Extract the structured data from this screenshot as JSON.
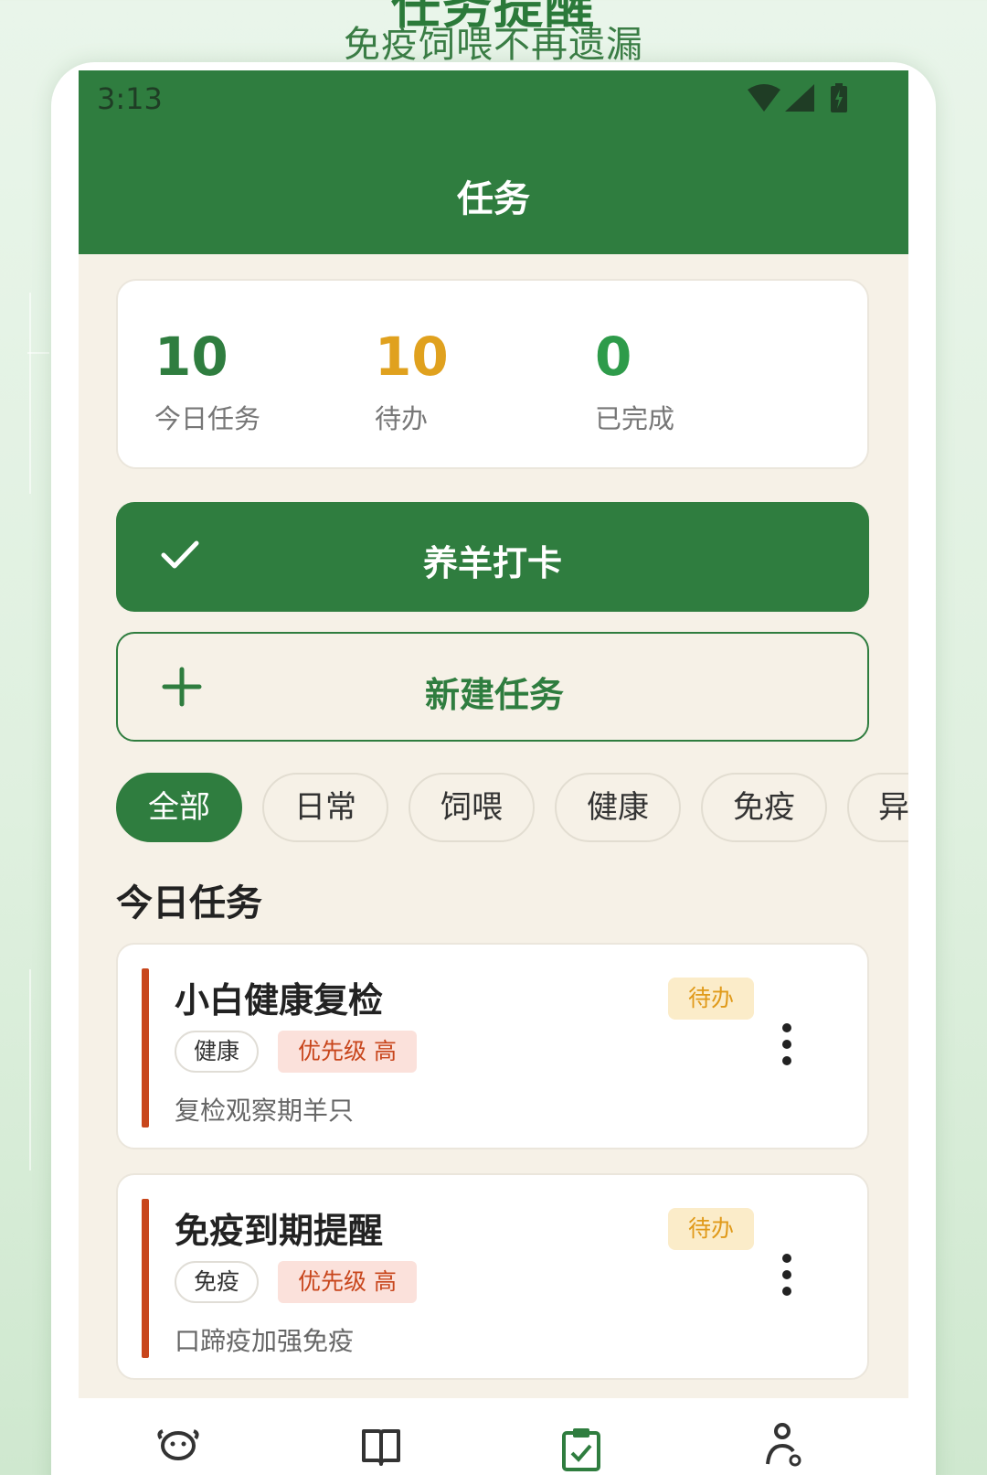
{
  "promo": {
    "title": "任务提醒",
    "subtitle": "免疫饲喂不再遗漏"
  },
  "statusbar": {
    "time": "3:13",
    "icons": [
      "wifi-icon",
      "signal-icon",
      "battery-icon"
    ]
  },
  "appbar": {
    "title": "任务"
  },
  "stats": [
    {
      "value": "10",
      "label": "今日任务",
      "color": "#2f7d3f"
    },
    {
      "value": "10",
      "label": "待办",
      "color": "#e0a11e"
    },
    {
      "value": "0",
      "label": "已完成",
      "color": "#2e9b4a"
    }
  ],
  "actions": {
    "checkin_label": "养羊打卡",
    "new_task_label": "新建任务"
  },
  "filters": {
    "selected": "全部",
    "items": [
      "全部",
      "日常",
      "饲喂",
      "健康",
      "免疫",
      "异"
    ]
  },
  "section_title": "今日任务",
  "tasks": [
    {
      "title": "小白健康复检",
      "status": "待办",
      "category": "健康",
      "priority": "优先级 高",
      "description": "复检观察期羊只"
    },
    {
      "title": "免疫到期提醒",
      "status": "待办",
      "category": "免疫",
      "priority": "优先级 高",
      "description": "口蹄疫加强免疫"
    }
  ],
  "bottom_nav": {
    "items": [
      "sheep-icon",
      "book-icon",
      "task-clipboard-icon",
      "profile-icon"
    ],
    "active": "task-clipboard-icon"
  },
  "colors": {
    "primary": "#2f7d3f",
    "accent_pending": "#e0a11e",
    "priority_high": "#c8461c",
    "background": "#f6f1e7"
  }
}
